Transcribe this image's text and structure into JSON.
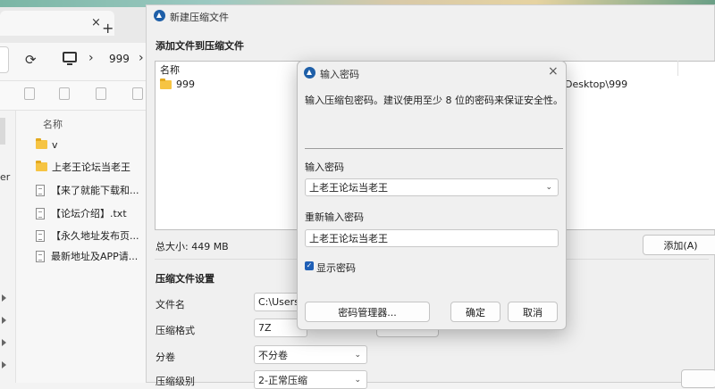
{
  "explorer": {
    "tab_close": "×",
    "new_tab": "+",
    "refresh_icon": "⟳",
    "breadcrumb_sep": "›",
    "path_segment": "999",
    "column_header": "名称",
    "sidebar_text": "er",
    "files": [
      {
        "type": "folder",
        "name": "v"
      },
      {
        "type": "folder",
        "name": "上老王论坛当老王"
      },
      {
        "type": "doc",
        "name": "【来了就能下载和..."
      },
      {
        "type": "doc",
        "name": "【论坛介绍】.txt"
      },
      {
        "type": "doc",
        "name": "【永久地址发布页..."
      },
      {
        "type": "doc",
        "name": "最新地址及APP请..."
      }
    ]
  },
  "main_dialog": {
    "title": "新建压缩文件",
    "add_section": "添加文件到压缩文件",
    "list_header": "名称",
    "list_item": "999",
    "list_path": "Desktop\\999",
    "total_size": "总大小: 449 MB",
    "add_button": "添加(A)",
    "settings_section": "压缩文件设置",
    "filename_label": "文件名",
    "filename_value": "C:\\Users\\",
    "format_label": "压缩格式",
    "format_value": "7Z",
    "split_label": "分卷",
    "split_value": "不分卷",
    "level_label": "压缩级别",
    "level_value": "2-正常压缩"
  },
  "password_dialog": {
    "title": "输入密码",
    "close": "×",
    "description": "输入压缩包密码。建议使用至少 8 位的密码来保证安全性。",
    "password_label": "输入密码",
    "password_value": "上老王论坛当老王",
    "confirm_label": "重新输入密码",
    "confirm_value": "上老王论坛当老王",
    "show_password": "显示密码",
    "show_password_checked": true,
    "manager_button": "密码管理器...",
    "ok_button": "确定",
    "cancel_button": "取消"
  },
  "colors": {
    "accent": "#1f5fb6",
    "folder": "#f6c443"
  }
}
